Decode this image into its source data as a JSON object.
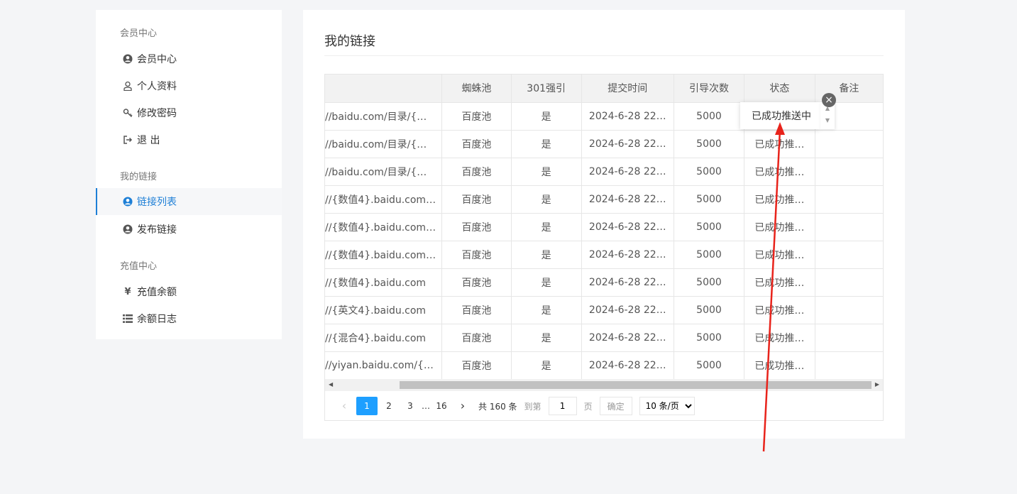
{
  "sidebar": {
    "groups": [
      {
        "title": "会员中心",
        "items": [
          {
            "label": "会员中心",
            "icon": "user-circle-icon"
          },
          {
            "label": "个人资料",
            "icon": "user-outline-icon"
          },
          {
            "label": "修改密码",
            "icon": "key-icon"
          },
          {
            "label": "退 出",
            "icon": "logout-icon"
          }
        ]
      },
      {
        "title": "我的链接",
        "items": [
          {
            "label": "链接列表",
            "icon": "user-circle-icon",
            "active": true
          },
          {
            "label": "发布链接",
            "icon": "user-circle-icon"
          }
        ]
      },
      {
        "title": "充值中心",
        "items": [
          {
            "label": "充值余额",
            "icon": "yen-icon"
          },
          {
            "label": "余额日志",
            "icon": "list-icon"
          }
        ]
      }
    ]
  },
  "main": {
    "title": "我的链接",
    "table": {
      "headers": [
        "",
        "蜘蛛池",
        "301强引",
        "提交时间",
        "引导次数",
        "状态",
        "备注"
      ],
      "rows": [
        [
          "//baidu.com/目录/{…",
          "百度池",
          "是",
          "2024-6-28 22…",
          "5000",
          "",
          ""
        ],
        [
          "//baidu.com/目录/{…",
          "百度池",
          "是",
          "2024-6-28 22…",
          "5000",
          "已成功推…",
          ""
        ],
        [
          "//baidu.com/目录/{…",
          "百度池",
          "是",
          "2024-6-28 22…",
          "5000",
          "已成功推…",
          ""
        ],
        [
          "//{数值4}.baidu.com…",
          "百度池",
          "是",
          "2024-6-28 22…",
          "5000",
          "已成功推…",
          ""
        ],
        [
          "//{数值4}.baidu.com…",
          "百度池",
          "是",
          "2024-6-28 22…",
          "5000",
          "已成功推…",
          ""
        ],
        [
          "//{数值4}.baidu.com…",
          "百度池",
          "是",
          "2024-6-28 22…",
          "5000",
          "已成功推…",
          ""
        ],
        [
          "//{数值4}.baidu.com",
          "百度池",
          "是",
          "2024-6-28 22…",
          "5000",
          "已成功推…",
          ""
        ],
        [
          "//{英文4}.baidu.com",
          "百度池",
          "是",
          "2024-6-28 22…",
          "5000",
          "已成功推…",
          ""
        ],
        [
          "//{混合4}.baidu.com",
          "百度池",
          "是",
          "2024-6-28 22…",
          "5000",
          "已成功推…",
          ""
        ],
        [
          "//yiyan.baidu.com/{…",
          "百度池",
          "是",
          "2024-6-28 22…",
          "5000",
          "已成功推…",
          ""
        ]
      ]
    },
    "tooltip": {
      "text": "已成功推送中"
    },
    "pagination": {
      "prev": "‹",
      "pages": [
        "1",
        "2",
        "3"
      ],
      "ellipsis": "…",
      "last": "16",
      "next": "›",
      "total": "共 160 条",
      "goto_label": "到第",
      "goto_value": "1",
      "page_unit": "页",
      "confirm": "确定",
      "page_size": "10 条/页",
      "page_size_options": [
        "10 条/页"
      ]
    }
  },
  "colors": {
    "accent": "#1e9fff",
    "active_nav": "#1e7fd6",
    "arrow": "#e8231b"
  }
}
